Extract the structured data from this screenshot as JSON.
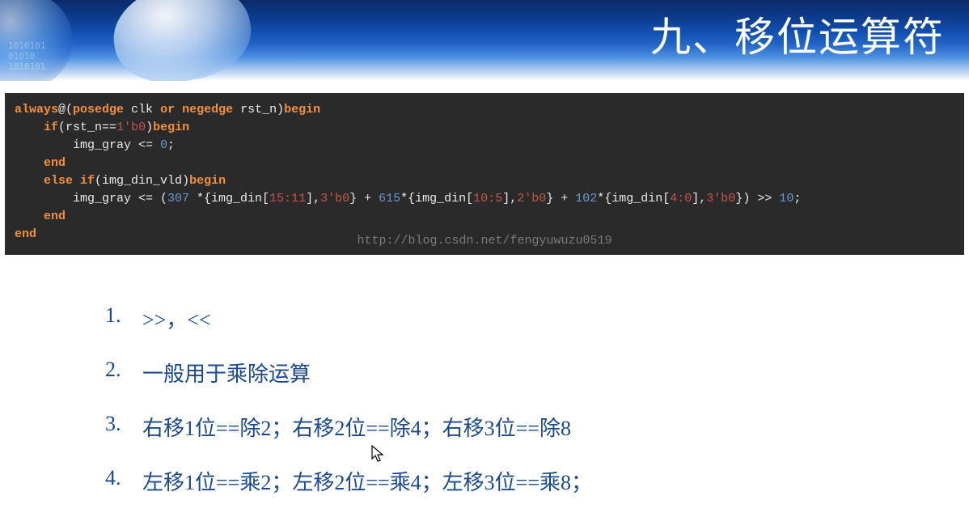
{
  "header": {
    "title": "九、移位运算符",
    "binary_decor": "1010101\n01010\n1010101"
  },
  "code": {
    "line1_always": "always",
    "line1_at": "@(",
    "line1_posedge": "posedge",
    "line1_clk": " clk ",
    "line1_or": "or",
    "line1_negedge": " negedge",
    "line1_rstn": " rst_n",
    "line1_end": ")",
    "line1_begin": "begin",
    "line2_if": "    if",
    "line2_cond_open": "(",
    "line2_rstn": "rst_n",
    "line2_eq": "==",
    "line2_val": "1'b0",
    "line2_cond_close": ")",
    "line2_begin": "begin",
    "line3": "        img_gray <= ",
    "line3_zero": "0",
    "line3_semi": ";",
    "line4_end": "    end",
    "line5_else": "    else",
    "line5_if": " if",
    "line5_open": "(",
    "line5_var": "img_din_vld",
    "line5_close": ")",
    "line5_begin": "begin",
    "line6_pre": "        img_gray <= (",
    "line6_307": "307",
    "line6_m1": " *{img_din[",
    "line6_15_11": "15:11",
    "line6_c1": "],",
    "line6_b1": "3'b0",
    "line6_p1": "} + ",
    "line6_615": "615",
    "line6_m2": "*{img_din[",
    "line6_10_5": "10:5",
    "line6_c2": "],",
    "line6_b2": "2'b0",
    "line6_p2": "} + ",
    "line6_102": "102",
    "line6_m3": "*{img_din[",
    "line6_4_0": "4:0",
    "line6_c3": "],",
    "line6_b3": "3'b0",
    "line6_p3": "}) >> ",
    "line6_10": "10",
    "line6_semi": ";",
    "line7_end": "    end",
    "line8_end": "end"
  },
  "watermark": "http://blog.csdn.net/fengyuwuzu0519",
  "list": {
    "items": [
      {
        "num": "1.",
        "text": ">>，<<"
      },
      {
        "num": "2.",
        "text": "一般用于乘除运算"
      },
      {
        "num": "3.",
        "text": "右移1位==除2；右移2位==除4；右移3位==除8"
      },
      {
        "num": "4.",
        "text": "左移1位==乘2；左移2位==乘4；左移3位==乘8；"
      }
    ]
  }
}
